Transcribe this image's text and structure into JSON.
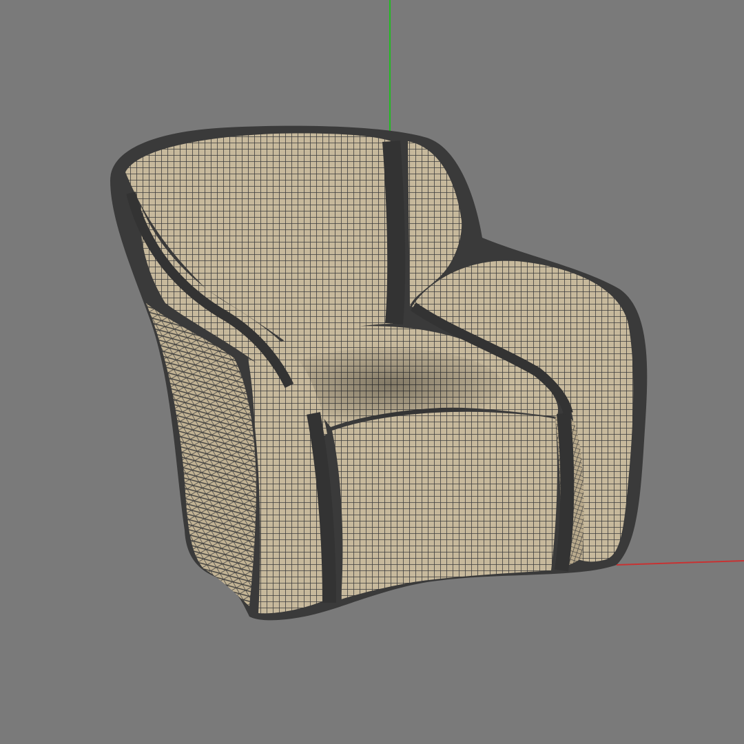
{
  "viewport": {
    "background": "#7a7a7a"
  },
  "axes": {
    "y_axis_color": "#22bb22",
    "x_axis_color": "#c83232"
  },
  "model": {
    "name": "armchair-wireframe-mesh",
    "surface_color": "#c7b99c",
    "wire_color": "#3c3c3c"
  }
}
